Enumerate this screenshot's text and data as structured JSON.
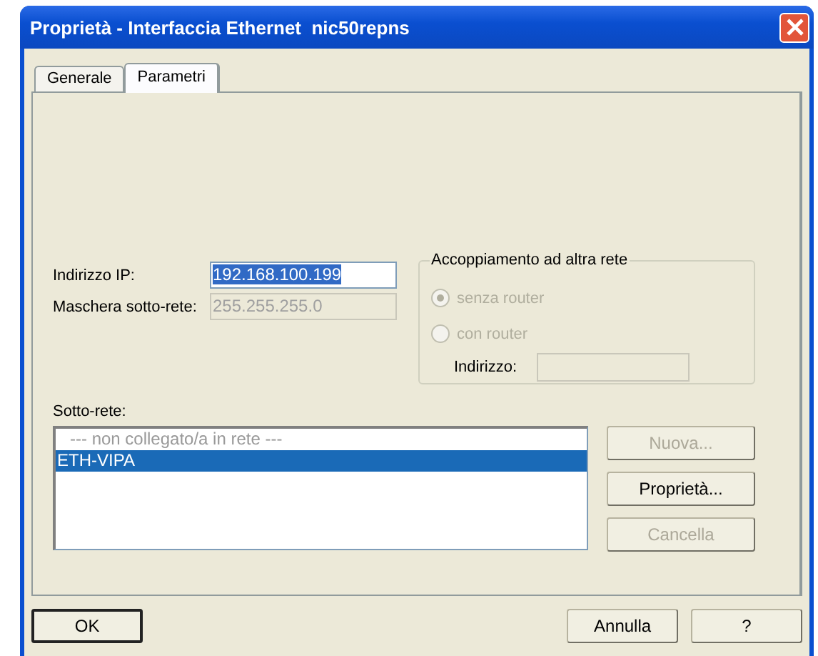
{
  "window": {
    "title": "Proprietà - Interfaccia Ethernet  nic50repns"
  },
  "tabs": [
    {
      "label": "Generale",
      "selected": false
    },
    {
      "label": "Parametri",
      "selected": true
    }
  ],
  "fields": [
    {
      "label": "Indirizzo IP:",
      "value": "192.168.100.199",
      "disabled": false,
      "selected": true
    },
    {
      "label": "Maschera sotto-rete:",
      "value": "255.255.255.0",
      "disabled": true,
      "selected": false
    }
  ],
  "router_group": {
    "title": "Accoppiamento ad altra rete",
    "options": [
      {
        "label": "senza router",
        "checked": true,
        "disabled": true
      },
      {
        "label": "con router",
        "checked": false,
        "disabled": true
      }
    ],
    "address": {
      "label": "Indirizzo:",
      "disabled": true
    }
  },
  "subnet": {
    "label": "Sotto-rete:",
    "items": [
      {
        "label": "--- non collegato/a in rete ---",
        "kind": "placeholder",
        "selected": false
      },
      {
        "label": "ETH-VIPA",
        "kind": "entry",
        "selected": true
      }
    ],
    "buttons": [
      {
        "label": "Nuova...",
        "disabled": true
      },
      {
        "label": "Proprietà...",
        "disabled": false
      },
      {
        "label": "Cancella",
        "disabled": true
      }
    ]
  },
  "buttons": [
    {
      "label": "OK",
      "default": true
    },
    {
      "label": "Annulla",
      "default": false
    },
    {
      "label": "?",
      "default": false
    }
  ]
}
